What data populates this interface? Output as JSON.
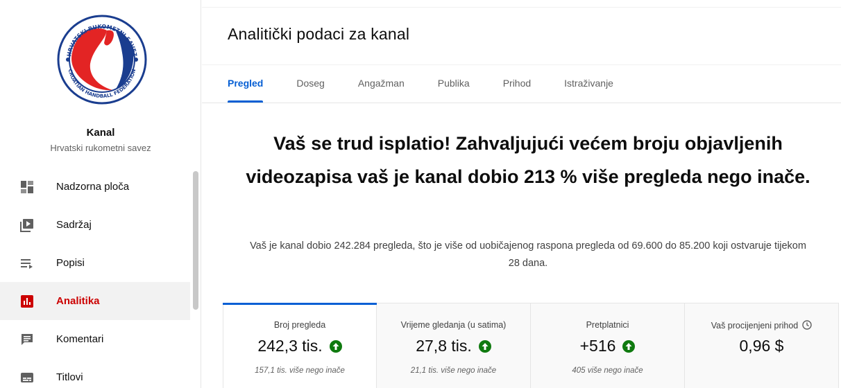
{
  "sidebar": {
    "logo": {
      "top_text": "HRVATSKI RUKOMETNI SAVEZ",
      "bottom_text": "CROATIAN HANDBALL FEDERATION"
    },
    "channel_title": "Kanal",
    "channel_name": "Hrvatski rukometni savez",
    "items": [
      {
        "label": "Nadzorna ploča",
        "icon": "dashboard-icon",
        "active": false
      },
      {
        "label": "Sadržaj",
        "icon": "content-icon",
        "active": false
      },
      {
        "label": "Popisi",
        "icon": "playlists-icon",
        "active": false
      },
      {
        "label": "Analitika",
        "icon": "analytics-icon",
        "active": true
      },
      {
        "label": "Komentari",
        "icon": "comments-icon",
        "active": false
      },
      {
        "label": "Titlovi",
        "icon": "subtitles-icon",
        "active": false
      }
    ]
  },
  "header": {
    "title": "Analitički podaci za kanal"
  },
  "tabs": [
    {
      "label": "Pregled",
      "active": true
    },
    {
      "label": "Doseg",
      "active": false
    },
    {
      "label": "Angažman",
      "active": false
    },
    {
      "label": "Publika",
      "active": false
    },
    {
      "label": "Prihod",
      "active": false
    },
    {
      "label": "Istraživanje",
      "active": false
    }
  ],
  "main": {
    "headline": "Vaš se trud isplatio! Zahvaljujući većem broju objavljenih videozapisa vaš je kanal dobio 213 % više pregleda nego inače.",
    "subtext": "Vaš je kanal dobio 242.284 pregleda, što je više od uobičajenog raspona pregleda od 69.600 do 85.200 koji ostvaruje tijekom 28 dana."
  },
  "cards": [
    {
      "label": "Broj pregleda",
      "value": "242,3 tis.",
      "trend": "up",
      "note": "157,1 tis. više nego inače",
      "active": true
    },
    {
      "label": "Vrijeme gledanja (u satima)",
      "value": "27,8 tis.",
      "trend": "up",
      "note": "21,1 tis. više nego inače",
      "active": false
    },
    {
      "label": "Pretplatnici",
      "value": "+516",
      "trend": "up",
      "note": "405 više nego inače",
      "active": false
    },
    {
      "label": "Vaš procijenjeni prihod",
      "value": "0,96 $",
      "trend": "",
      "note": "",
      "active": false
    }
  ],
  "colors": {
    "accent_blue": "#065fd4",
    "active_red": "#cc0000",
    "trend_green": "#0f7a0f",
    "logo_blue": "#1a3d8f",
    "logo_red": "#e32424"
  }
}
